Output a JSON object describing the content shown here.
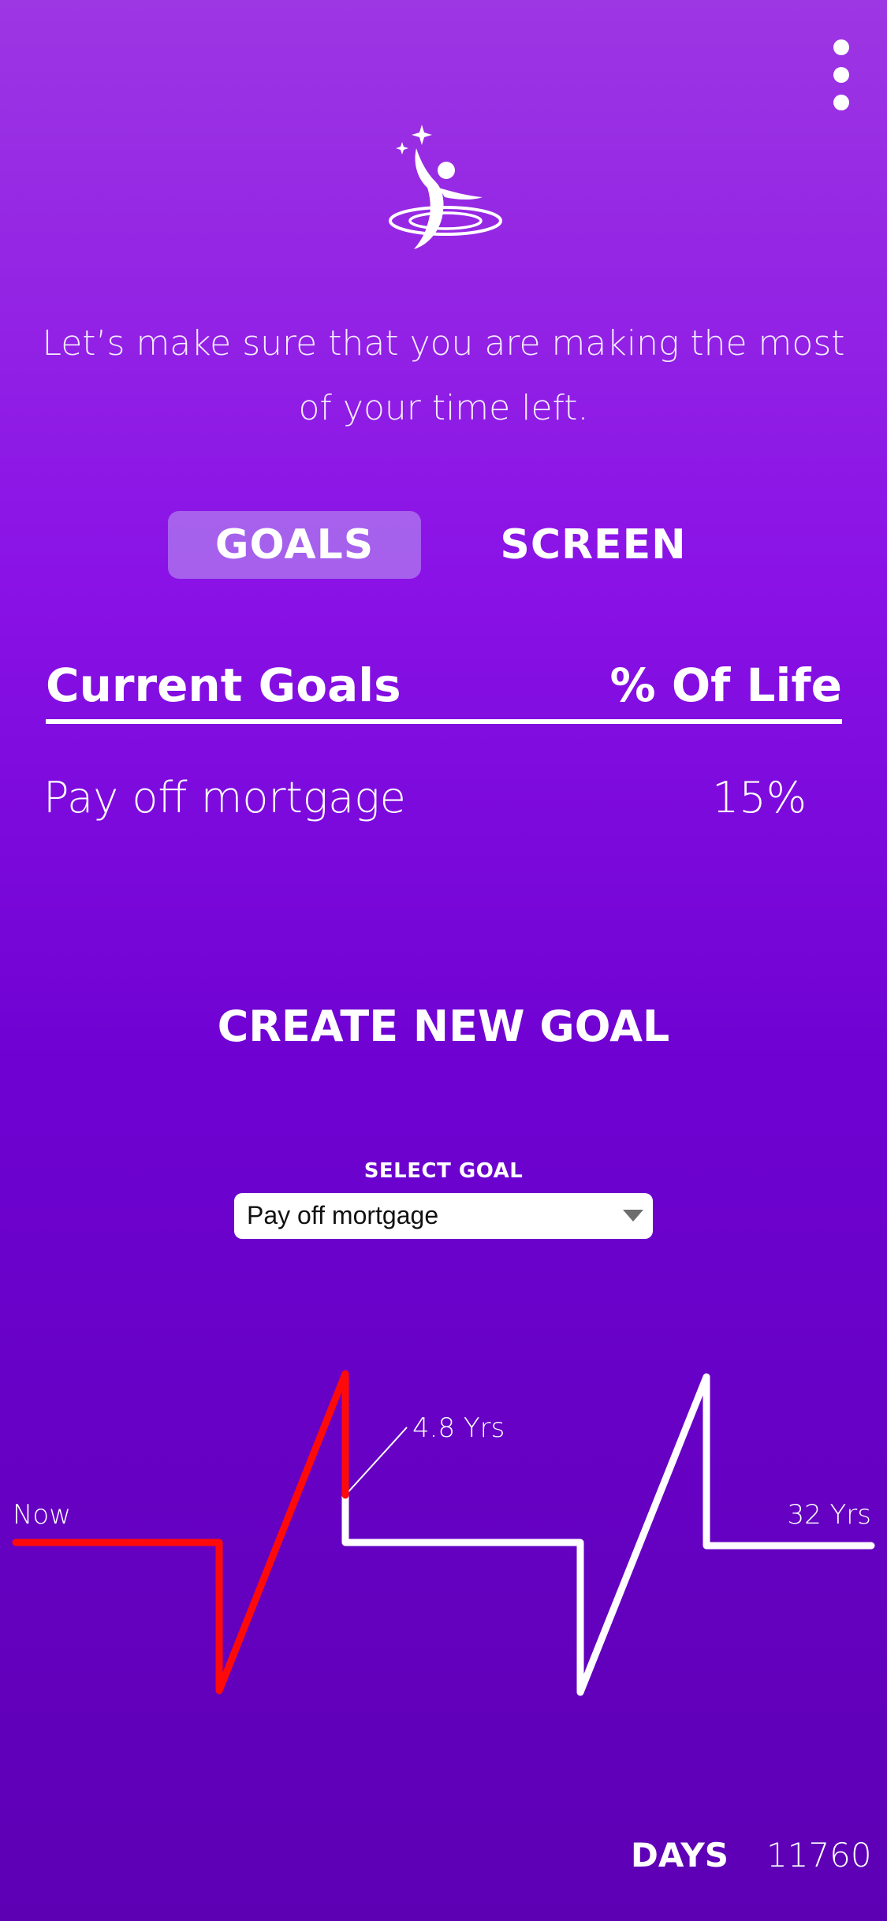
{
  "header": {
    "menu_icon": "vertical-dots-icon",
    "logo_icon": "reaching-figure-logo"
  },
  "tagline": "Let’s make sure that you are making the most of your time left.",
  "tabs": [
    {
      "label": "GOALS",
      "active": true
    },
    {
      "label": "SCREEN",
      "active": false
    }
  ],
  "goals_table": {
    "headers": [
      "Current Goals",
      "% Of Life"
    ],
    "rows": [
      {
        "goal": "Pay off mortgage",
        "percent": "15%"
      }
    ]
  },
  "create_goal_label": "CREATE NEW GOAL",
  "select_goal": {
    "label": "SELECT GOAL",
    "value": "Pay off mortgage"
  },
  "timeline": {
    "start_label": "Now",
    "end_label": "32 Yrs",
    "goal_marker_label": "4.8 Yrs",
    "goal_years": 4.8,
    "total_years": 32,
    "colors": {
      "elapsed": "#ff0a0a",
      "remaining": "#ffffff"
    }
  },
  "days": {
    "label": "DAYS",
    "value": "11760"
  }
}
